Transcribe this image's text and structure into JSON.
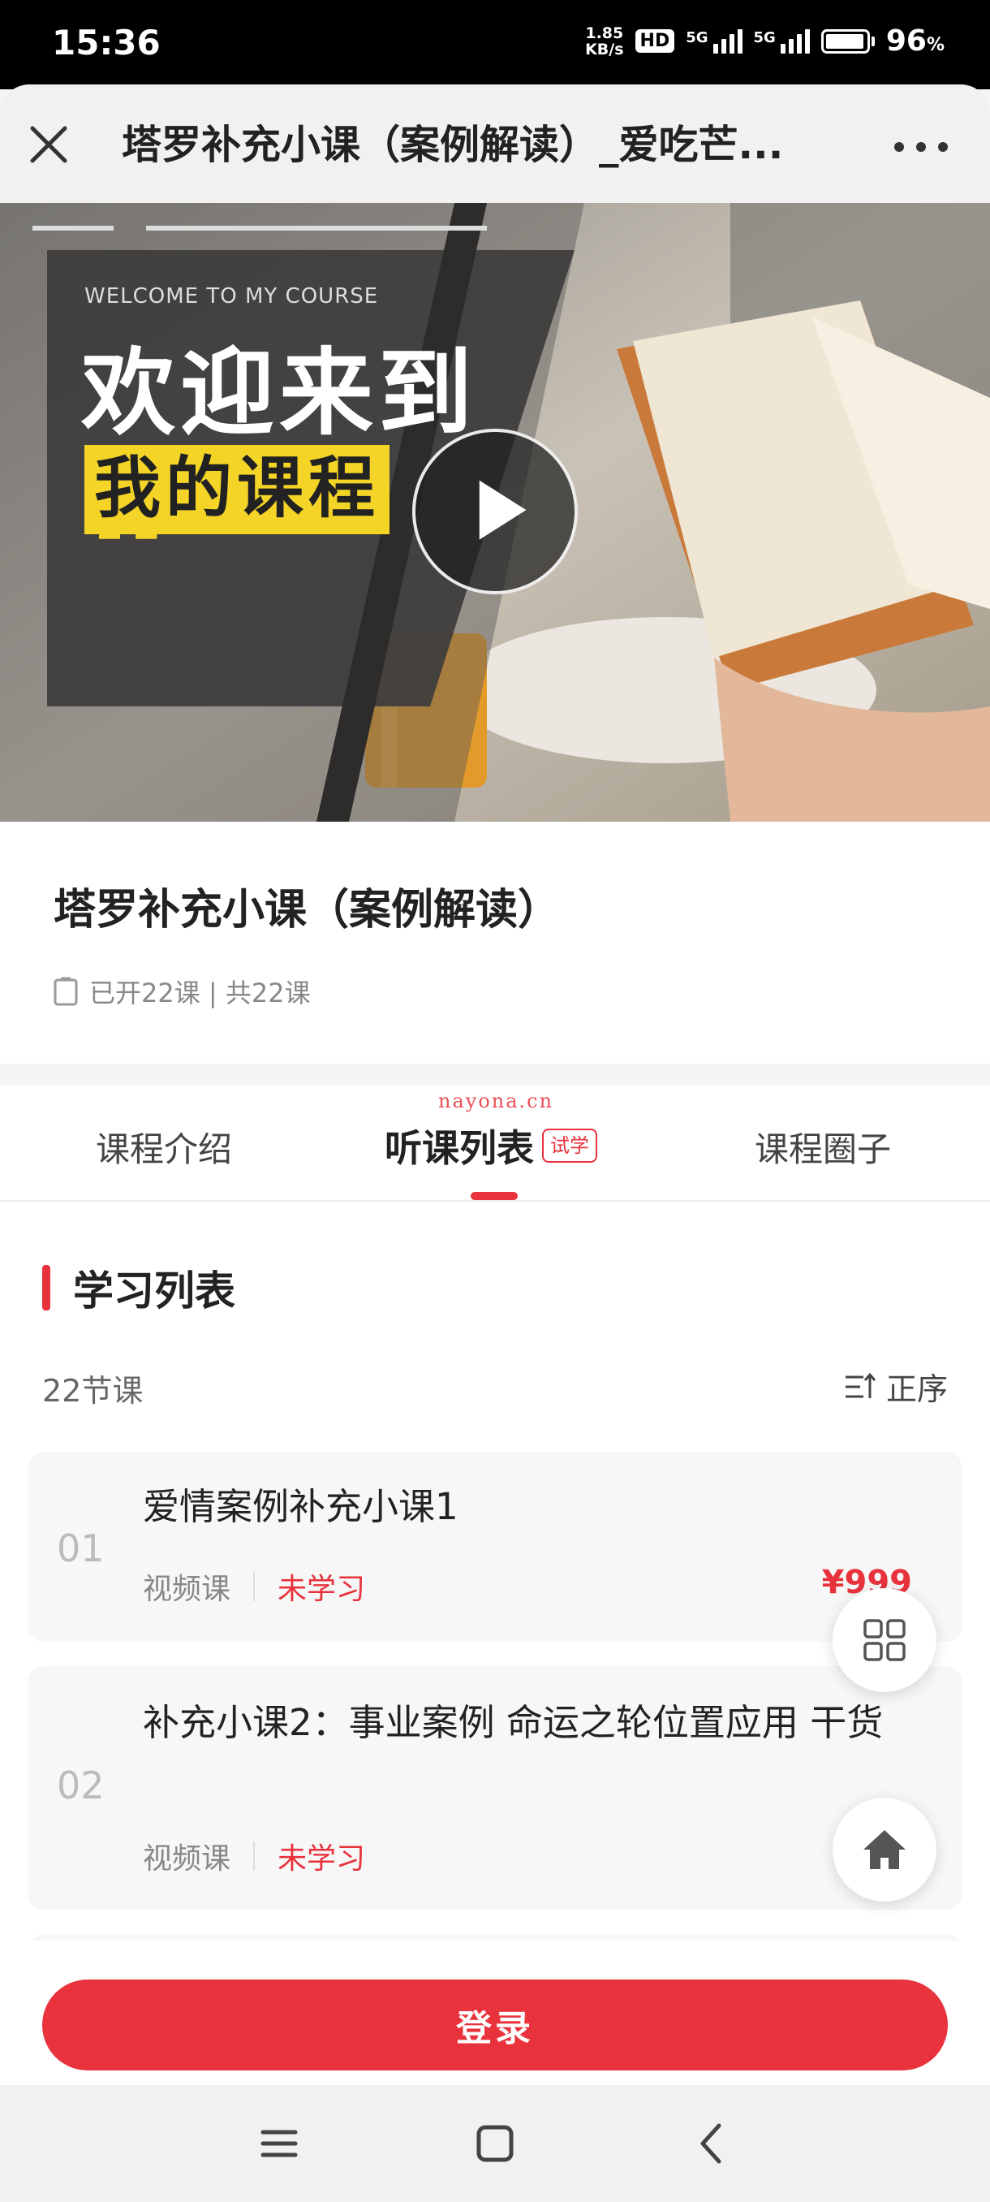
{
  "status_bar": {
    "time": "15:36",
    "net_speed_value": "1.85",
    "net_speed_unit": "KB/s",
    "hd": "HD",
    "signal_1": "5G",
    "signal_2": "5G",
    "battery_percent": "96",
    "battery_unit": "%"
  },
  "header": {
    "title": "塔罗补充小课（案例解读）_爱吃芒...",
    "close_icon": "close-icon",
    "more_icon": "more-icon"
  },
  "banner": {
    "welcome": "WELCOME TO MY COURSE",
    "line1": "欢迎来到",
    "line2": "我的课程",
    "play_icon": "play-icon"
  },
  "course": {
    "title": "塔罗补充小课（案例解读）",
    "meta": "已开22课 | 共22课"
  },
  "watermark": "nayona.cn",
  "tabs": {
    "intro": "课程介绍",
    "list": "听课列表",
    "trial_badge": "试学",
    "circle": "课程圈子",
    "active": "list"
  },
  "section": {
    "title": "学习列表",
    "lesson_count": "22节课",
    "sort_label": "正序"
  },
  "lessons": [
    {
      "num": "01",
      "title": "爱情案例补充小课1",
      "type": "视频课",
      "status": "未学习",
      "price": "¥999"
    },
    {
      "num": "02",
      "title": "补充小课2：事业案例 命运之轮位置应用 干货",
      "type": "视频课",
      "status": "未学习",
      "price": ""
    }
  ],
  "floating": {
    "grid_icon": "grid-icon",
    "home_icon": "home-icon"
  },
  "login": {
    "label": "登录"
  },
  "colors": {
    "accent": "#e8323c",
    "highlight": "#f4d426"
  }
}
